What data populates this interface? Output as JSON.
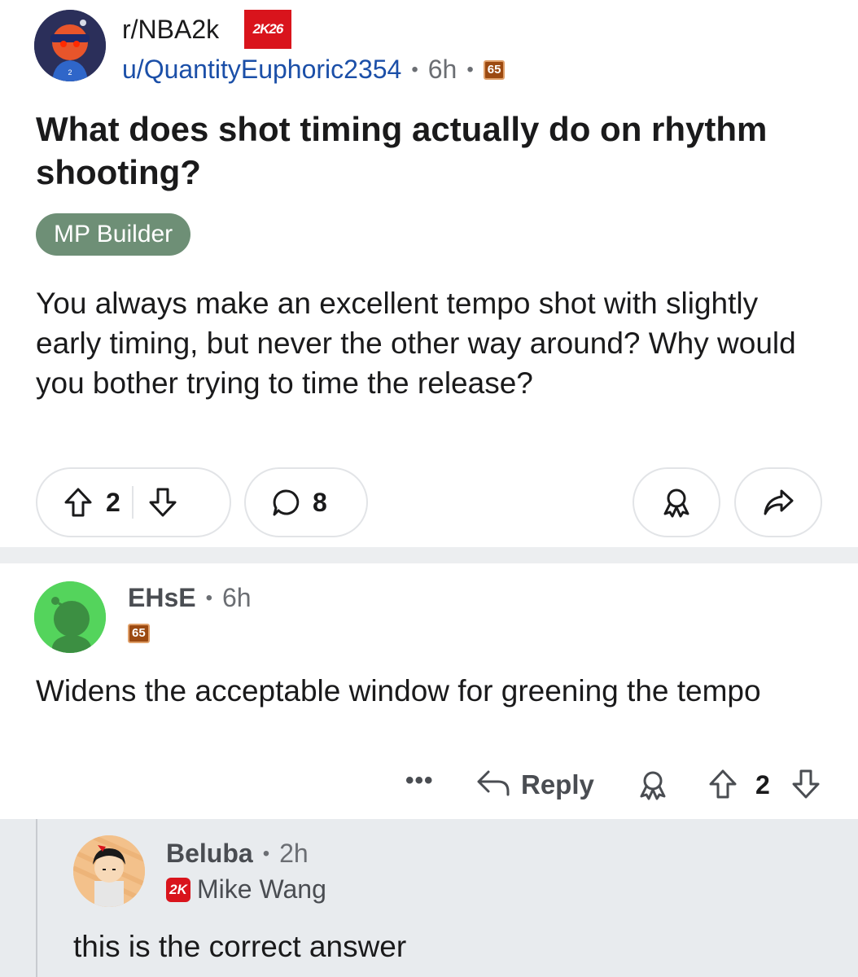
{
  "post": {
    "subreddit": "r/NBA2k",
    "subreddit_flair": "2K26",
    "author": "u/QuantityEuphoric2354",
    "age": "6h",
    "author_level": "65",
    "title": "What does shot timing actually do on rhythm shooting?",
    "flair": "MP Builder",
    "body": "You always make an excellent tempo shot with slightly early timing, but never the other way around? Why would you bother trying to time the release?",
    "votes": "2",
    "comments": "8"
  },
  "comments": [
    {
      "author": "EHsE",
      "age": "6h",
      "level": "65",
      "body": "Widens the acceptable window for greening the tempo",
      "actions": {
        "more": "•••",
        "reply": "Reply",
        "votes": "2"
      }
    }
  ],
  "replies": [
    {
      "author": "Beluba",
      "age": "2h",
      "flair_icon": "2K",
      "flair": "Mike Wang",
      "body": "this is the correct answer"
    }
  ],
  "colors": {
    "link_blue": "#1b4fa8",
    "flair_green": "#6e8f76",
    "level_badge": "#9c4a11",
    "brand_red": "#d9141c",
    "avatar_green": "#54d45c"
  }
}
